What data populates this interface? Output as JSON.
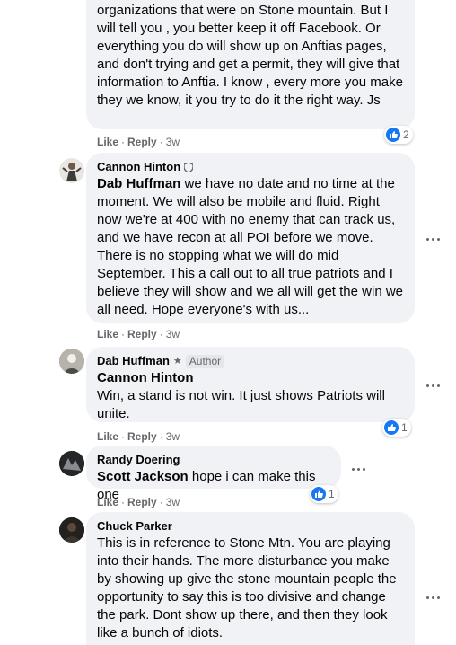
{
  "actions": {
    "like": "Like",
    "reply": "Reply",
    "sep": "·"
  },
  "comments": [
    {
      "author": "",
      "text": "organizations that were on Stone mountain. But I will tell you , you better keep it off Facebook. Or everything you do will show up on Anftias pages, and don't trying and get a permit, they will give that information to Anftia. I know , every more you make they we know, it you try to do it the right way. Js",
      "time": "3w",
      "reactions": "2"
    },
    {
      "author": "Cannon Hinton",
      "mention": "Dab Huffman",
      "text": " we have no date and no time at the moment. We will also be mobile and fluid. Right now we're at 400 with no enemy that can track us, and we have recon at all POI before we move. There is no stopping what we will do mid September. This a call out to all true patriots and I believe they will show and we all will get the win we all need. Hope everyone's with us...",
      "time": "3w"
    },
    {
      "author": "Dab Huffman",
      "badge": "Author",
      "mention": "Cannon Hinton",
      "text": "Win, a stand is not win. It just shows Patriots will unite.",
      "time": "3w",
      "reactions": "1"
    },
    {
      "author": "Randy Doering",
      "mention": "Scott Jackson",
      "text": " hope i can make this one",
      "time": "3w",
      "reactions": "1"
    },
    {
      "author": "Chuck Parker",
      "text": "This is in reference to Stone Mtn. You are playing into their hands. The more disturbance you make by showing up give the stone mountain people the opportunity to say this is too divisive and change the park. Dont show up there, and then they look like a bunch of idiots."
    }
  ]
}
